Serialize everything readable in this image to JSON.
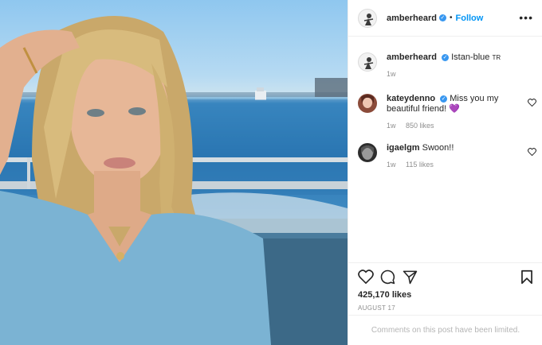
{
  "post": {
    "author": "amberheard",
    "separator": "•",
    "follow_label": "Follow",
    "more_label": "•••",
    "caption": {
      "user": "amberheard",
      "text": "Istan-blue",
      "location_code": "TR",
      "time": "1w"
    },
    "comments": [
      {
        "user": "kateydenno",
        "text": "Miss you my beautiful friend!",
        "emoji": "💜",
        "time": "1w",
        "likes": "850 likes",
        "verified": true
      },
      {
        "user": "igaelgm",
        "text": "Swoon!!",
        "time": "1w",
        "likes": "115 likes",
        "verified": false
      }
    ],
    "likes_count": "425,170 likes",
    "date": "AUGUST 17",
    "comments_limited": "Comments on this post have been limited."
  },
  "icons": {
    "verified": "verified-badge-icon",
    "heart": "heart-icon",
    "comment": "comment-icon",
    "share": "share-icon",
    "save": "bookmark-icon"
  },
  "colors": {
    "accent": "#0095f6",
    "verified": "#3897f0",
    "muted": "#8e8e8e",
    "text": "#262626"
  }
}
